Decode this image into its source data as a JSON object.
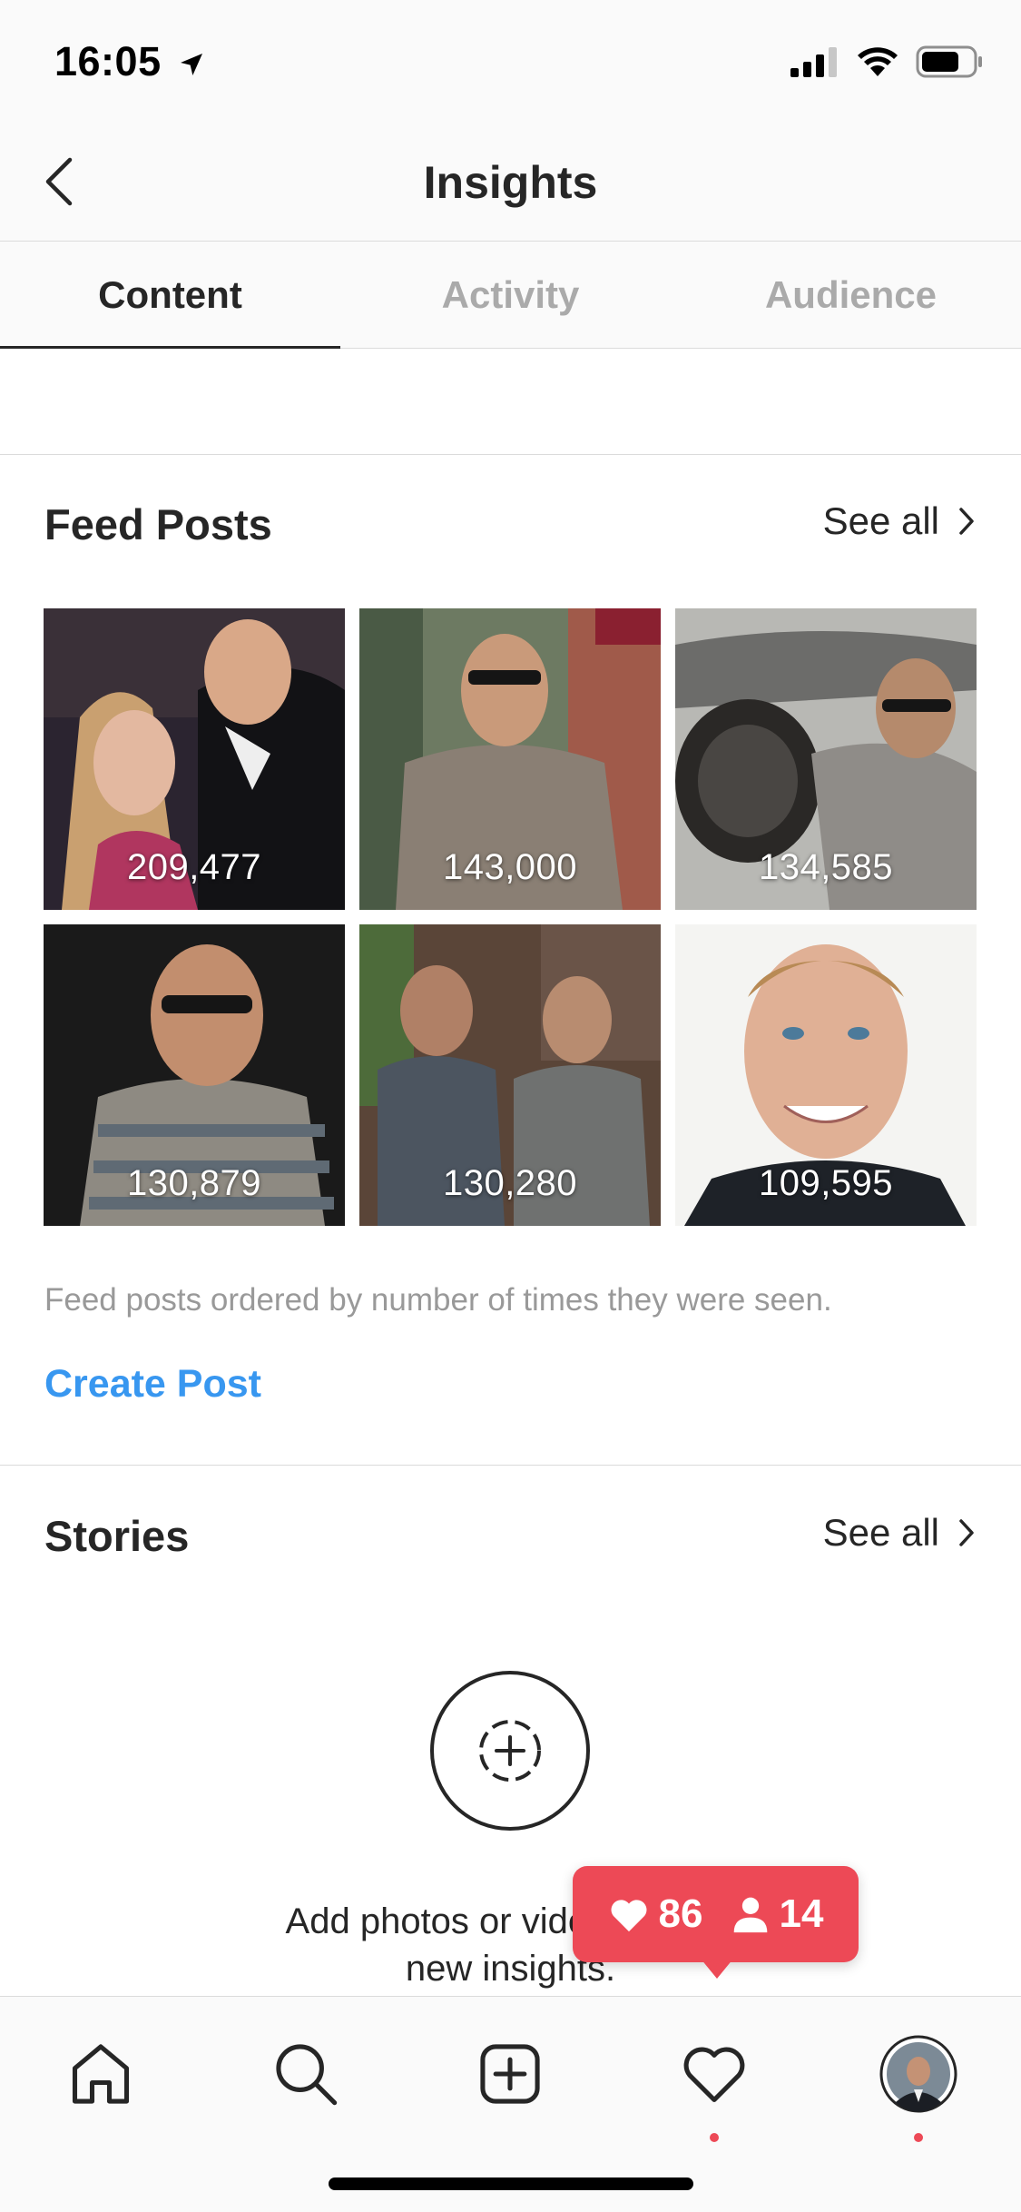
{
  "status_bar": {
    "time": "16:05"
  },
  "header": {
    "title": "Insights"
  },
  "tabs": [
    {
      "label": "Content",
      "active": true
    },
    {
      "label": "Activity",
      "active": false
    },
    {
      "label": "Audience",
      "active": false
    }
  ],
  "feed_posts": {
    "title": "Feed Posts",
    "see_all": "See all",
    "posts": [
      {
        "count": "209,477"
      },
      {
        "count": "143,000"
      },
      {
        "count": "134,585"
      },
      {
        "count": "130,879"
      },
      {
        "count": "130,280"
      },
      {
        "count": "109,595"
      }
    ],
    "note": "Feed posts ordered by number of times they were seen.",
    "create_label": "Create Post"
  },
  "stories": {
    "title": "Stories",
    "see_all": "See all",
    "empty_line1": "Add photos or videos to see",
    "empty_line2": "new insights."
  },
  "notification": {
    "likes": "86",
    "followers": "14"
  },
  "colors": {
    "accent": "#3897f0",
    "notification": "#ed4956",
    "text": "#262626",
    "muted": "#999999"
  }
}
